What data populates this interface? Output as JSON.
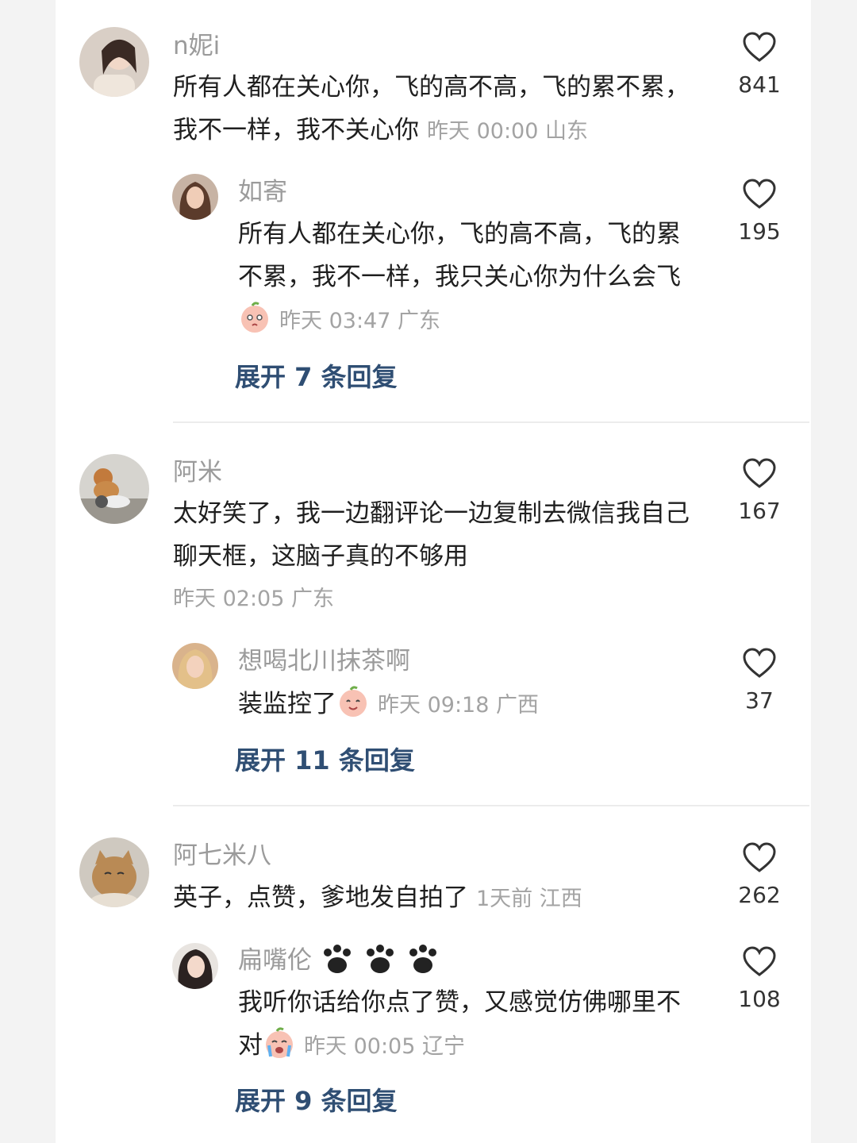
{
  "comments": [
    {
      "user": "n妮i",
      "text": "所有人都在关心你，飞的高不高，飞的累不累，我不一样，我不关心你",
      "time": "昨天 00:00",
      "location": "山东",
      "likes": "841",
      "reply": {
        "user": "如寄",
        "text": "所有人都在关心你，飞的高不高，飞的累不累，我不一样，我只关心你为什么会飞",
        "emoji": "blush-face-emoji",
        "time": "昨天 03:47",
        "location": "广东",
        "likes": "195"
      },
      "expand": "展开 7 条回复"
    },
    {
      "user": "阿米",
      "text": "太好笑了，我一边翻评论一边复制去微信我自己聊天框，这脑子真的不够用",
      "time": "昨天 02:05",
      "location": "广东",
      "likes": "167",
      "reply": {
        "user": "想喝北川抹茶啊",
        "text": "装监控了",
        "emoji": "smile-face-emoji",
        "time": "昨天 09:18",
        "location": "广西",
        "likes": "37"
      },
      "expand": "展开 11 条回复"
    },
    {
      "user": "阿七米八",
      "text": "英子，点赞，爹地发自拍了",
      "time": "1天前",
      "location": "江西",
      "likes": "262",
      "reply": {
        "user": "扁嘴伦",
        "name_icons": [
          "paw-icon",
          "paw-icon",
          "paw-icon"
        ],
        "text": "我听你话给你点了赞，又感觉仿佛哪里不对",
        "emoji": "crying-face-emoji",
        "time": "昨天 00:05",
        "location": "辽宁",
        "likes": "108"
      },
      "expand": "展开 9 条回复"
    }
  ],
  "colors": {
    "username": "#9b9b9b",
    "text": "#1f1f1f",
    "meta": "#a3a3a3",
    "expand": "#2f4e73"
  }
}
